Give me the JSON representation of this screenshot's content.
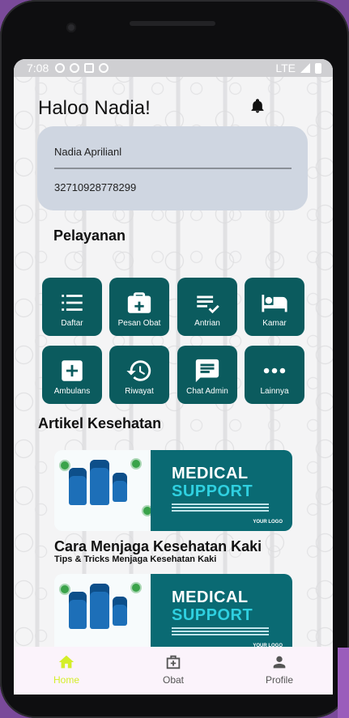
{
  "status_bar": {
    "time": "7:08",
    "network": "LTE"
  },
  "header": {
    "greeting": "Haloo Nadia!"
  },
  "profile_card": {
    "name": "Nadia Aprilianl",
    "id_number": "32710928778299"
  },
  "services": {
    "heading": "Pelayanan",
    "items": [
      {
        "label": "Daftar",
        "icon": "list-icon"
      },
      {
        "label": "Pesan Obat",
        "icon": "medical-kit-icon"
      },
      {
        "label": "Antrian",
        "icon": "queue-check-icon"
      },
      {
        "label": "Kamar",
        "icon": "bed-icon"
      },
      {
        "label": "Ambulans",
        "icon": "plus-box-icon"
      },
      {
        "label": "Riwayat",
        "icon": "history-icon"
      },
      {
        "label": "Chat Admin",
        "icon": "chat-icon"
      },
      {
        "label": "Lainnya",
        "icon": "more-icon"
      }
    ]
  },
  "articles": {
    "heading": "Artikel Kesehatan",
    "banner": {
      "line1": "MEDICAL",
      "line2": "SUPPORT",
      "logo": "YOUR LOGO"
    },
    "first": {
      "title": "Cara Menjaga Kesehatan Kaki",
      "subtitle": "Tips & Tricks Menjaga Kesehatan Kaki"
    }
  },
  "bottom_nav": {
    "items": [
      {
        "label": "Home",
        "icon": "home-icon",
        "active": true
      },
      {
        "label": "Obat",
        "icon": "medicine-box-icon",
        "active": false
      },
      {
        "label": "Profile",
        "icon": "person-icon",
        "active": false
      }
    ]
  },
  "colors": {
    "tile": "#0b5b5e",
    "card": "#cfd6e1",
    "nav_active": "#d4ee2a",
    "banner_teal": "#0a6a73"
  }
}
